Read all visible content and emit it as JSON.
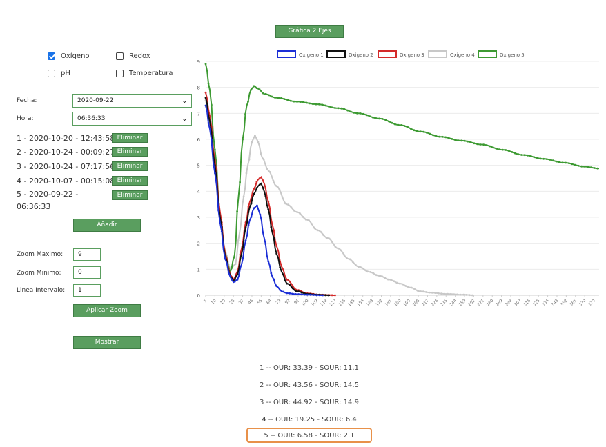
{
  "chart_toggle_button": "Gráfica 2 Ejes",
  "sensors": [
    {
      "label": "Oxígeno",
      "checked": true
    },
    {
      "label": "Redox",
      "checked": false
    },
    {
      "label": "pH",
      "checked": false
    },
    {
      "label": "Temperatura",
      "checked": false
    }
  ],
  "fecha": {
    "label": "Fecha:",
    "value": "2020-09-22"
  },
  "hora": {
    "label": "Hora:",
    "value": "06:36:33"
  },
  "registros": [
    {
      "text": "1 - 2020-10-20 - 12:43:58",
      "button": "Eliminar"
    },
    {
      "text": "2 - 2020-10-24 - 00:09:27",
      "button": "Eliminar"
    },
    {
      "text": "3 - 2020-10-24 - 07:17:56",
      "button": "Eliminar"
    },
    {
      "text": "4 - 2020-10-07 - 00:15:08",
      "button": "Eliminar"
    },
    {
      "text": "5 - 2020-09-22 -",
      "text2": "06:36:33",
      "button": "Eliminar"
    }
  ],
  "anadir_button": "Añadir",
  "zoom": {
    "max_label": "Zoom Maximo:",
    "max_value": "9",
    "min_label": "Zoom Minimo:",
    "min_value": "0",
    "interval_label": "Linea Intervalo:",
    "interval_value": "1"
  },
  "aplicar_zoom_button": "Aplicar Zoom",
  "mostrar_button": "Mostrar",
  "results": [
    "1 -- OUR: 33.39 - SOUR: 11.1",
    "2 -- OUR: 43.56 - SOUR: 14.5",
    "3 -- OUR: 44.92 - SOUR: 14.9",
    "4 -- OUR: 19.25 - SOUR: 6.4",
    "5 -- OUR: 6.58 - SOUR: 2.1"
  ],
  "chart_data": {
    "type": "line",
    "ylim": [
      0,
      9
    ],
    "yticks": [
      0,
      1,
      2,
      3,
      4,
      5,
      6,
      7,
      8,
      9
    ],
    "x_tick_labels": [
      "1",
      "10",
      "19",
      "28",
      "37",
      "46",
      "55",
      "64",
      "73",
      "82",
      "91",
      "100",
      "109",
      "118",
      "127",
      "136",
      "145",
      "154",
      "163",
      "172",
      "181",
      "190",
      "199",
      "208",
      "217",
      "226",
      "235",
      "244",
      "253",
      "262",
      "271",
      "280",
      "289",
      "298",
      "307",
      "316",
      "325",
      "334",
      "343",
      "352",
      "361",
      "370",
      "379"
    ],
    "x_range": [
      1,
      384
    ],
    "series": [
      {
        "name": "Oxigeno 1",
        "color": "#1c2fd6",
        "points": [
          [
            1,
            7.3
          ],
          [
            5,
            6.4
          ],
          [
            10,
            4.7
          ],
          [
            15,
            2.8
          ],
          [
            20,
            1.4
          ],
          [
            25,
            0.7
          ],
          [
            28,
            0.5
          ],
          [
            32,
            0.6
          ],
          [
            36,
            1.2
          ],
          [
            40,
            2.1
          ],
          [
            44,
            2.9
          ],
          [
            48,
            3.35
          ],
          [
            51,
            3.45
          ],
          [
            54,
            3.1
          ],
          [
            58,
            2.2
          ],
          [
            62,
            1.3
          ],
          [
            66,
            0.7
          ],
          [
            70,
            0.35
          ],
          [
            75,
            0.15
          ],
          [
            80,
            0.08
          ],
          [
            90,
            0.04
          ],
          [
            100,
            0.02
          ],
          [
            115,
            0.0
          ]
        ]
      },
      {
        "name": "Oxigeno 2",
        "color": "#111111",
        "points": [
          [
            1,
            7.6
          ],
          [
            5,
            6.7
          ],
          [
            10,
            5.0
          ],
          [
            15,
            3.0
          ],
          [
            20,
            1.5
          ],
          [
            25,
            0.75
          ],
          [
            28,
            0.55
          ],
          [
            32,
            0.8
          ],
          [
            36,
            1.6
          ],
          [
            40,
            2.6
          ],
          [
            44,
            3.4
          ],
          [
            48,
            3.9
          ],
          [
            52,
            4.2
          ],
          [
            55,
            4.3
          ],
          [
            58,
            4.0
          ],
          [
            62,
            3.3
          ],
          [
            66,
            2.4
          ],
          [
            70,
            1.6
          ],
          [
            75,
            0.9
          ],
          [
            80,
            0.45
          ],
          [
            90,
            0.15
          ],
          [
            100,
            0.05
          ],
          [
            110,
            0.02
          ],
          [
            122,
            0.0
          ]
        ]
      },
      {
        "name": "Oxigeno 3",
        "color": "#d42a2a",
        "points": [
          [
            1,
            7.8
          ],
          [
            5,
            6.9
          ],
          [
            10,
            5.2
          ],
          [
            15,
            3.2
          ],
          [
            20,
            1.6
          ],
          [
            25,
            0.8
          ],
          [
            28,
            0.6
          ],
          [
            32,
            0.9
          ],
          [
            36,
            1.8
          ],
          [
            40,
            2.8
          ],
          [
            44,
            3.6
          ],
          [
            48,
            4.1
          ],
          [
            52,
            4.45
          ],
          [
            55,
            4.55
          ],
          [
            58,
            4.3
          ],
          [
            62,
            3.6
          ],
          [
            66,
            2.7
          ],
          [
            70,
            1.9
          ],
          [
            75,
            1.1
          ],
          [
            80,
            0.6
          ],
          [
            90,
            0.2
          ],
          [
            100,
            0.07
          ],
          [
            112,
            0.02
          ],
          [
            127,
            0.0
          ]
        ]
      },
      {
        "name": "Oxigeno 4",
        "color": "#c8c8c8",
        "points": [
          [
            1,
            7.5
          ],
          [
            5,
            6.5
          ],
          [
            10,
            4.9
          ],
          [
            15,
            3.1
          ],
          [
            20,
            1.7
          ],
          [
            25,
            1.0
          ],
          [
            30,
            1.2
          ],
          [
            34,
            2.4
          ],
          [
            38,
            3.8
          ],
          [
            42,
            5.0
          ],
          [
            46,
            5.9
          ],
          [
            49,
            6.15
          ],
          [
            52,
            5.9
          ],
          [
            56,
            5.3
          ],
          [
            62,
            4.8
          ],
          [
            70,
            4.2
          ],
          [
            80,
            3.5
          ],
          [
            90,
            3.2
          ],
          [
            100,
            2.9
          ],
          [
            110,
            2.5
          ],
          [
            120,
            2.2
          ],
          [
            130,
            1.8
          ],
          [
            140,
            1.4
          ],
          [
            150,
            1.1
          ],
          [
            160,
            0.9
          ],
          [
            170,
            0.75
          ],
          [
            180,
            0.6
          ],
          [
            190,
            0.45
          ],
          [
            200,
            0.3
          ],
          [
            210,
            0.15
          ],
          [
            220,
            0.1
          ],
          [
            235,
            0.05
          ],
          [
            252,
            0.02
          ],
          [
            262,
            0.0
          ]
        ]
      },
      {
        "name": "Oxigeno 5",
        "color": "#3d9a32",
        "points": [
          [
            1,
            8.9
          ],
          [
            5,
            7.9
          ],
          [
            10,
            5.6
          ],
          [
            15,
            3.1
          ],
          [
            20,
            1.6
          ],
          [
            25,
            0.9
          ],
          [
            29,
            1.5
          ],
          [
            33,
            3.8
          ],
          [
            37,
            6.0
          ],
          [
            41,
            7.3
          ],
          [
            45,
            7.9
          ],
          [
            48,
            8.05
          ],
          [
            52,
            7.95
          ],
          [
            58,
            7.75
          ],
          [
            70,
            7.6
          ],
          [
            90,
            7.45
          ],
          [
            110,
            7.35
          ],
          [
            130,
            7.2
          ],
          [
            150,
            7.0
          ],
          [
            170,
            6.8
          ],
          [
            190,
            6.55
          ],
          [
            210,
            6.3
          ],
          [
            230,
            6.1
          ],
          [
            250,
            5.95
          ],
          [
            270,
            5.8
          ],
          [
            290,
            5.6
          ],
          [
            310,
            5.4
          ],
          [
            330,
            5.25
          ],
          [
            350,
            5.1
          ],
          [
            370,
            4.95
          ],
          [
            384,
            4.88
          ]
        ]
      }
    ]
  }
}
